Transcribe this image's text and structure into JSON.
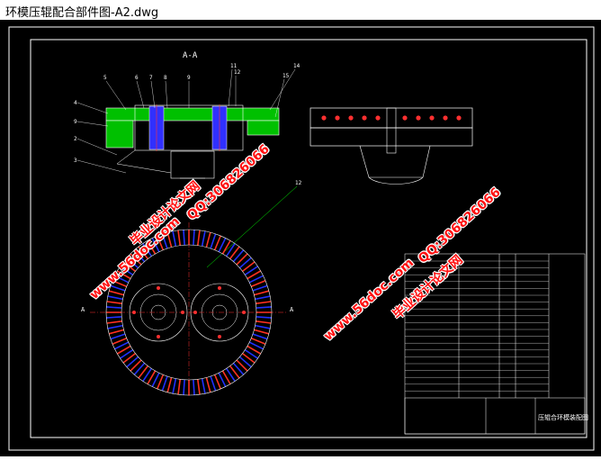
{
  "window": {
    "title": "环模压辊配合部件图-A2.dwg"
  },
  "drawing": {
    "section_label": "A-A",
    "section_marks": [
      "A",
      "A"
    ],
    "callouts_left": [
      "4",
      "9",
      "2",
      "3"
    ],
    "callouts_top": [
      "5",
      "6",
      "7",
      "8",
      "9",
      "10",
      "11",
      "12",
      "13",
      "14",
      "15"
    ],
    "leader_label": "12",
    "title_block_name": "压辊合环模装配图"
  },
  "watermarks": {
    "site": "www.56doc.com",
    "qq": "QQ:306826066",
    "brand": "毕业设计论文网"
  },
  "colors": {
    "background": "#000000",
    "frame": "#ffffff",
    "green": "#00c000",
    "teeth_blue": "#2030ff",
    "teeth_red": "#ff3020",
    "watermark": "#ff1010"
  }
}
